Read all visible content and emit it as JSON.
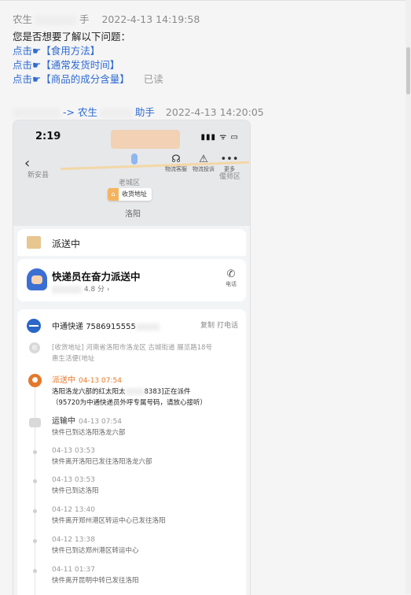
{
  "message1": {
    "sender": "农生",
    "sender_suffix": "手",
    "timestamp": "2022-4-13 14:19:58",
    "prompt": "您是否想要了解以下问题：",
    "options": [
      {
        "prefix": "点击☛",
        "label": "【食用方法】"
      },
      {
        "prefix": "点击☛",
        "label": "【通常发货时间】"
      },
      {
        "prefix": "点击☛",
        "label": "【商品的成分含量】"
      }
    ],
    "read_status": "已读"
  },
  "message2": {
    "sender_arrow": "-> 农生",
    "sender_suffix": "助手",
    "timestamp": "2022-4-13 14:20:05"
  },
  "phone": {
    "status_time": "2:19",
    "status_icons": "▮▮▮ ᯤ ▭",
    "map_labels": {
      "left": "新安县",
      "center": "老城区",
      "city": "洛阳",
      "right": "偃师区"
    },
    "tools": [
      {
        "icon": "headset-icon",
        "glyph": "☊",
        "label": "物流客服"
      },
      {
        "icon": "warning-icon",
        "glyph": "⚠",
        "label": "物流投诉"
      },
      {
        "icon": "more-icon",
        "glyph": "•••",
        "label": "更多"
      }
    ],
    "pin_label": "收货地址",
    "shipping_status": "派送中",
    "courier_message": "快递员在奋力派送中",
    "courier_rating": "4.8 分 ›",
    "phone_label": "电话",
    "carrier": "中通快递",
    "tracking_number": "7586915555",
    "copy_label": "复制",
    "call_label": "打电话",
    "address_line": "[收货地址] 河南省洛阳市洛龙区 古城街道   展览路18号",
    "address_line2": "惠生活便(地址",
    "events": [
      {
        "status": "派送中",
        "time": "04-13 07:54",
        "desc": "洛阳洛龙六部的红太阳太",
        "desc_suffix": "8383]正在派件",
        "desc2": "（95720为中通快递员外呼专属号码，请放心接听）",
        "active": true
      },
      {
        "status": "运输中",
        "time": "04-13 07:54",
        "desc": "快件已到达洛阳洛龙六部"
      },
      {
        "status": "",
        "time": "04-13 03:53",
        "desc": "快件离开洛阳已发往洛阳洛龙六部"
      },
      {
        "status": "",
        "time": "04-13 03:53",
        "desc": "快件已到达洛阳"
      },
      {
        "status": "",
        "time": "04-12 13:40",
        "desc": "快件离开郑州港区转运中心已发往洛阳"
      },
      {
        "status": "",
        "time": "04-12 13:38",
        "desc": "快件已到达郑州港区转运中心"
      },
      {
        "status": "",
        "time": "04-11 01:37",
        "desc": "快件离开昆明中转已发往洛阳"
      }
    ]
  },
  "colors": {
    "link": "#2f6bd3",
    "accent_orange": "#e4782b",
    "carrier_blue": "#2a66c9"
  }
}
